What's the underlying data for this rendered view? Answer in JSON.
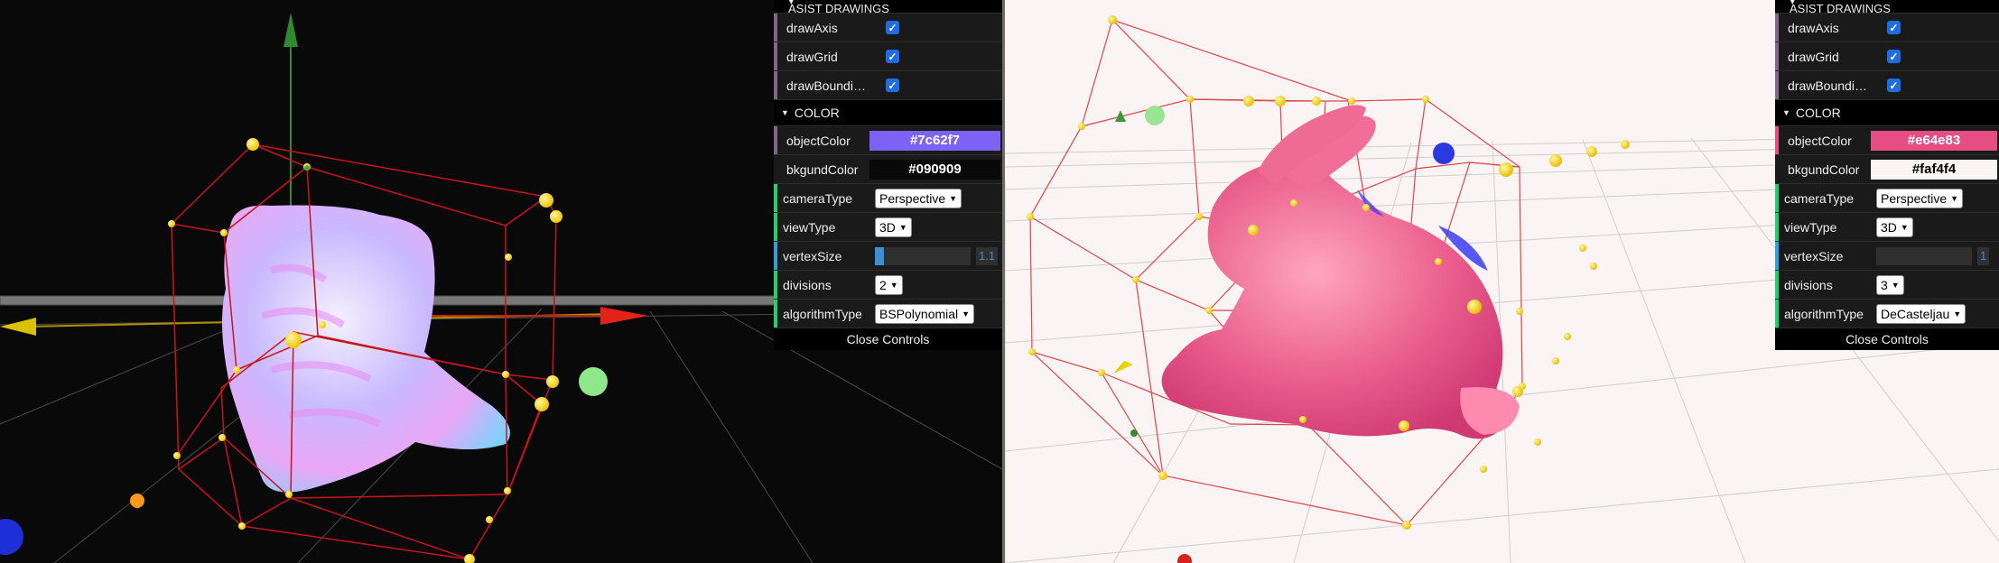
{
  "left_view": {
    "gui": {
      "folder_title": "ASIST DRAWINGS",
      "draw_axis_label": "drawAxis",
      "draw_grid_label": "drawGrid",
      "draw_bounding_label": "drawBounding…",
      "draw_axis": true,
      "draw_grid": true,
      "draw_bounding": true,
      "color_folder": "COLOR",
      "object_color_label": "objectColor",
      "object_color": "#7c62f7",
      "bkgund_color_label": "bkgundColor",
      "bkgund_color": "#090909",
      "camera_type_label": "cameraType",
      "camera_type": "Perspective",
      "view_type_label": "viewType",
      "view_type": "3D",
      "vertex_size_label": "vertexSize",
      "vertex_size": "1.1",
      "divisions_label": "divisions",
      "divisions": "2",
      "algorithm_type_label": "algorithmType",
      "algorithm_type": "BSPolynomial",
      "close_label": "Close Controls"
    }
  },
  "right_view": {
    "gui": {
      "folder_title": "ASIST DRAWINGS",
      "draw_axis_label": "drawAxis",
      "draw_grid_label": "drawGrid",
      "draw_bounding_label": "drawBounding…",
      "draw_axis": true,
      "draw_grid": true,
      "draw_bounding": true,
      "color_folder": "COLOR",
      "object_color_label": "objectColor",
      "object_color": "#e64e83",
      "bkgund_color_label": "bkgundColor",
      "bkgund_color": "#faf4f4",
      "camera_type_label": "cameraType",
      "camera_type": "Perspective",
      "view_type_label": "viewType",
      "view_type": "3D",
      "vertex_size_label": "vertexSize",
      "vertex_size": "1",
      "divisions_label": "divisions",
      "divisions": "3",
      "algorithm_type_label": "algorithmType",
      "algorithm_type": "DeCasteljau",
      "close_label": "Close Controls"
    }
  },
  "colors": {
    "bar_purple": "#806787",
    "bar_green": "#2fa1d6",
    "bar_blue": "#3c8fd6"
  }
}
